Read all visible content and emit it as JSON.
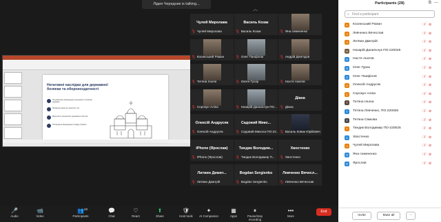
{
  "talking": "Лідия Чередник is talking...",
  "slide": {
    "title": "Негативні наслідки для державної безпеки та обороноздатності",
    "bullets": [
      "Послаблення міжнародної підтримки та безпеки держави",
      "Зниження рівня до захисних сил",
      "Відсутність визначеної державної політики",
      "Погіршення міжнародного іміджу України"
    ]
  },
  "gallery": [
    {
      "big": "Чулей Миролава",
      "label": "Чулей Миролава",
      "video": false
    },
    {
      "big": "Василь Козак",
      "label": "Василь Козак",
      "video": false
    },
    {
      "big": "",
      "label": "Яна семененко",
      "video": true
    },
    {
      "big": "",
      "label": "Косинський Роман",
      "video": true
    },
    {
      "big": "",
      "label": "Олег Панфілов",
      "video": true
    },
    {
      "big": "",
      "label": "Андрій Дем'ядов",
      "video": true
    },
    {
      "big": "",
      "label": "Тетяна Ільїна",
      "video": true
    },
    {
      "big": "",
      "label": "Євген Гусар",
      "video": true
    },
    {
      "big": "",
      "label": "Настя Акатов",
      "video": true
    },
    {
      "big": "",
      "label": "Сорокун Аліна",
      "video": true
    },
    {
      "big": "",
      "label": "Назарій Данильчук ПО...",
      "video": true
    },
    {
      "big": "Діана",
      "label": "Діана",
      "video": false
    },
    {
      "big": "Олексій Андрусяк",
      "label": "Олексій Андрусяк",
      "video": false
    },
    {
      "big": "Садовий Мико...",
      "label": "Садовий Микола ПО-22...",
      "video": false
    },
    {
      "big": "",
      "label": "Василь Ковик Юрійович",
      "video": true
    },
    {
      "big": "iPhone (Ярослав)",
      "label": "iPhone (Ярослав)",
      "video": false
    },
    {
      "big": "Тиндик Володим...",
      "label": "Тиндик Володимир П...",
      "video": false
    },
    {
      "big": "Хвостенко",
      "label": "Хвостенко",
      "video": false
    },
    {
      "big": "Литвин Димит...",
      "label": "Литвин Дмитрій",
      "video": false
    },
    {
      "big": "Bogdan Sergienko",
      "label": "Bogdan Sergienko",
      "video": false
    },
    {
      "big": "Левченко Вячесл...",
      "label": "Левченко Вячеслав",
      "video": false
    }
  ],
  "participants": {
    "title": "Participants (28)",
    "search_placeholder": "Find a participant",
    "invite": "Invite",
    "mute_all": "Mute all",
    "list": [
      {
        "initial": "К",
        "name": "Косинський Роман",
        "color": "#e8820c"
      },
      {
        "initial": "Л",
        "name": "Левченко Вячеслав",
        "color": "#e8820c"
      },
      {
        "initial": "Л",
        "name": "Литвин Дмитрій",
        "color": "#e8820c"
      },
      {
        "initial": "Н",
        "name": "Назарій Данильчук ПО-220026",
        "color": "#7a5c3c"
      },
      {
        "initial": "Н",
        "name": "Настя Акатов",
        "color": "#2d8bd8"
      },
      {
        "initial": "О",
        "name": "Олег Гурак",
        "color": "#2d8bd8"
      },
      {
        "initial": "О",
        "name": "Олег Панфілов",
        "color": "#2d8bd8"
      },
      {
        "initial": "О",
        "name": "Олексій Андрусяк",
        "color": "#e8820c"
      },
      {
        "initial": "С",
        "name": "Сорокун Аліна",
        "color": "#e8820c"
      },
      {
        "initial": "Т",
        "name": "Тетяна Ільїна",
        "color": "#5c4a3c"
      },
      {
        "initial": "Т",
        "name": "Тетяна Левченко, ПО-220026",
        "color": "#2d8bd8"
      },
      {
        "initial": "Т",
        "name": "Тетяна Сімкова",
        "color": "#4a4a4a"
      },
      {
        "initial": "Т",
        "name": "Тиндик Володимир ПО-220026",
        "color": "#e8820c"
      },
      {
        "initial": "Х",
        "name": "Хвостенко",
        "color": "#2d8bd8"
      },
      {
        "initial": "Ч",
        "name": "Чулей Миролава",
        "color": "#e8820c"
      },
      {
        "initial": "Я",
        "name": "Яна семененко",
        "color": "#2d8bd8"
      },
      {
        "initial": "Я",
        "name": "Ярослав",
        "color": "#2d8bd8"
      }
    ]
  },
  "toolbar": [
    {
      "label": "Audio",
      "icon": "🎤",
      "red": true
    },
    {
      "label": "Video",
      "icon": "📹",
      "red": true
    },
    {
      "label": "Participants",
      "icon": "👥",
      "red": false,
      "count": "28"
    },
    {
      "label": "Chat",
      "icon": "💬",
      "red": false
    },
    {
      "label": "React",
      "icon": "♡",
      "red": false
    },
    {
      "label": "Share",
      "icon": "⬆",
      "red": false,
      "green": true
    },
    {
      "label": "Host tools",
      "icon": "🛡",
      "red": false
    },
    {
      "label": "AI Companion",
      "icon": "✦",
      "red": false
    },
    {
      "label": "Apps",
      "icon": "▦",
      "red": false
    },
    {
      "label": "Pause/stop recording",
      "icon": "⏸",
      "red": false
    },
    {
      "label": "More",
      "icon": "•••",
      "red": false
    }
  ],
  "end_label": "End"
}
